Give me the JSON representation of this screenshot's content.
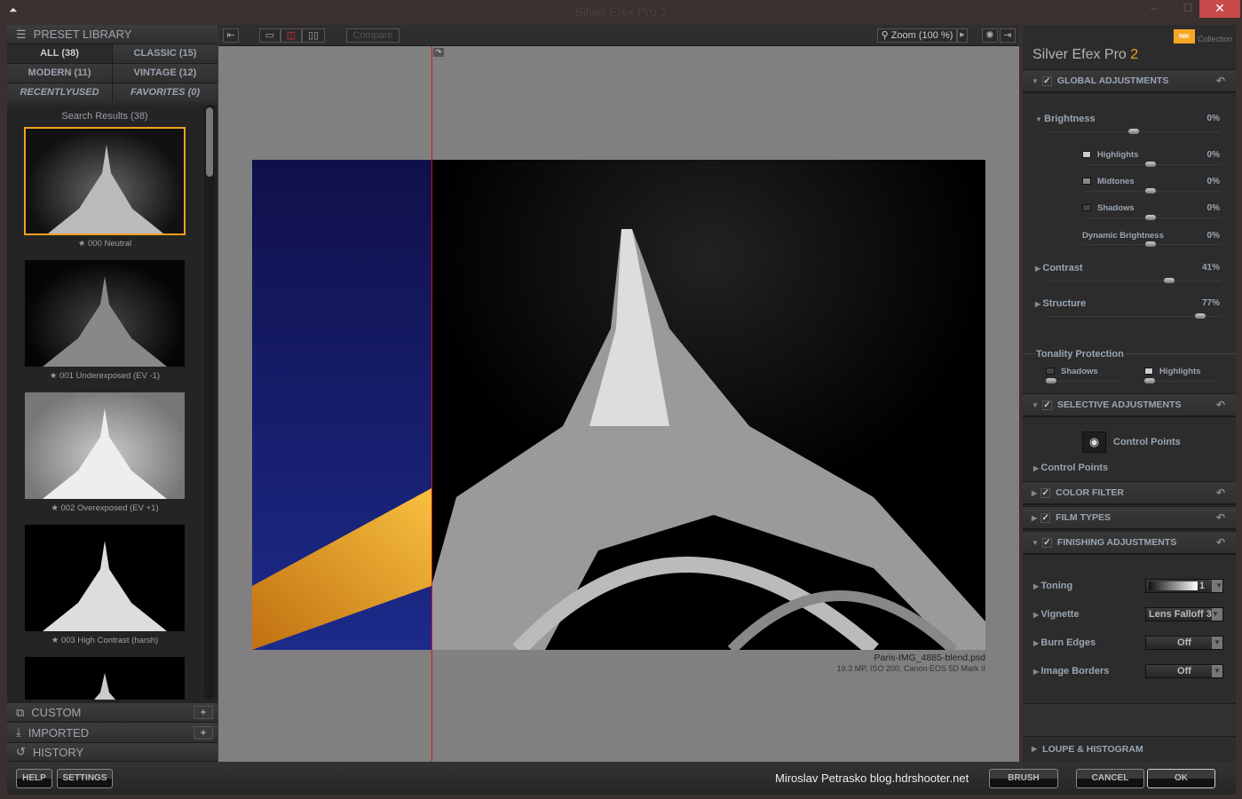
{
  "window": {
    "title": "Silver Efex Pro 2",
    "close": "✕",
    "minimize": "–",
    "maximize": "☐"
  },
  "preset_library": {
    "title": "PRESET LIBRARY",
    "tabs": [
      {
        "label": "ALL (38)",
        "selected": true
      },
      {
        "label": "CLASSIC (15)"
      },
      {
        "label": "MODERN (11)"
      },
      {
        "label": "VINTAGE (12)"
      },
      {
        "label": "RECENTLYUSED"
      },
      {
        "label": "FAVORITES (0)"
      }
    ],
    "results_label": "Search Results (38)",
    "presets": [
      {
        "label": "★ 000 Neutral",
        "selected": true
      },
      {
        "label": "★ 001 Underexposed (EV -1)"
      },
      {
        "label": "★ 002 Overexposed (EV +1)"
      },
      {
        "label": "★ 003 High Contrast (harsh)"
      }
    ],
    "sections": [
      {
        "label": "CUSTOM",
        "add": "+"
      },
      {
        "label": "IMPORTED",
        "add": "+"
      },
      {
        "label": "HISTORY"
      }
    ]
  },
  "toolbar": {
    "compare": "Compare",
    "zoom": "Zoom (100 %)"
  },
  "image": {
    "filename": "Paris-IMG_4885-blend.psd",
    "info": "19.3 MP, ISO 200, Canon EOS 5D Mark II"
  },
  "right_panel": {
    "brand": "Nik Collection",
    "logo": "NIK",
    "product": "Silver Efex Pro",
    "version": "2",
    "accent": "#f0a020",
    "global": {
      "title": "GLOBAL ADJUSTMENTS",
      "brightness": {
        "label": "Brightness",
        "value": "0%"
      },
      "sub": [
        {
          "label": "Highlights",
          "value": "0%"
        },
        {
          "label": "Midtones",
          "value": "0%"
        },
        {
          "label": "Shadows",
          "value": "0%"
        },
        {
          "label": "Dynamic Brightness",
          "value": "0%"
        }
      ],
      "contrast": {
        "label": "Contrast",
        "value": "41%",
        "percent": 41
      },
      "structure": {
        "label": "Structure",
        "value": "77%",
        "percent": 77
      },
      "tonality": {
        "label": "Tonality Protection",
        "shadows": "Shadows",
        "highlights": "Highlights"
      }
    },
    "selective": {
      "title": "SELECTIVE ADJUSTMENTS",
      "button": "Control Points",
      "list": "Control Points"
    },
    "color_filter": "COLOR FILTER",
    "film_types": "FILM TYPES",
    "finishing": {
      "title": "FINISHING ADJUSTMENTS",
      "rows": [
        {
          "label": "Toning",
          "value": "1"
        },
        {
          "label": "Vignette",
          "value": "Lens Falloff 3"
        },
        {
          "label": "Burn Edges",
          "value": "Off"
        },
        {
          "label": "Image Borders",
          "value": "Off"
        }
      ]
    },
    "loupe": "LOUPE & HISTOGRAM"
  },
  "bottom": {
    "help": "HELP",
    "settings": "SETTINGS",
    "credit": "Miroslav  Petrasko  blog.hdrshooter.net",
    "brush": "BRUSH",
    "cancel": "CANCEL",
    "ok": "OK"
  }
}
